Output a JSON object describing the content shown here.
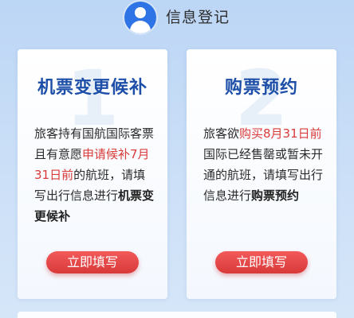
{
  "header": {
    "title": "信息登记",
    "icon": "user-avatar-icon",
    "accent_color": "#2f74e6"
  },
  "cards": [
    {
      "numeral": "1",
      "title": "机票变更候补",
      "desc": [
        {
          "text": "旅客持有国航国际客票且有意愿",
          "style": "normal"
        },
        {
          "text": "申请候补7月31日前",
          "style": "red"
        },
        {
          "text": "的航班，请填写出行信息进行",
          "style": "normal"
        },
        {
          "text": "机票变更候补",
          "style": "bold"
        }
      ],
      "button_label": "立即填写"
    },
    {
      "numeral": "2",
      "title": "购票预约",
      "desc": [
        {
          "text": "旅客欲",
          "style": "normal"
        },
        {
          "text": "购买8月31日前",
          "style": "red"
        },
        {
          "text": "国际已经售罄或暂未开通的航班，请填写出行信息进行",
          "style": "normal"
        },
        {
          "text": "购票预约",
          "style": "bold"
        }
      ],
      "button_label": "立即填写"
    }
  ],
  "colors": {
    "title_blue": "#1d4fa8",
    "highlight_red": "#d93a3a",
    "button_red": "#e34848"
  }
}
